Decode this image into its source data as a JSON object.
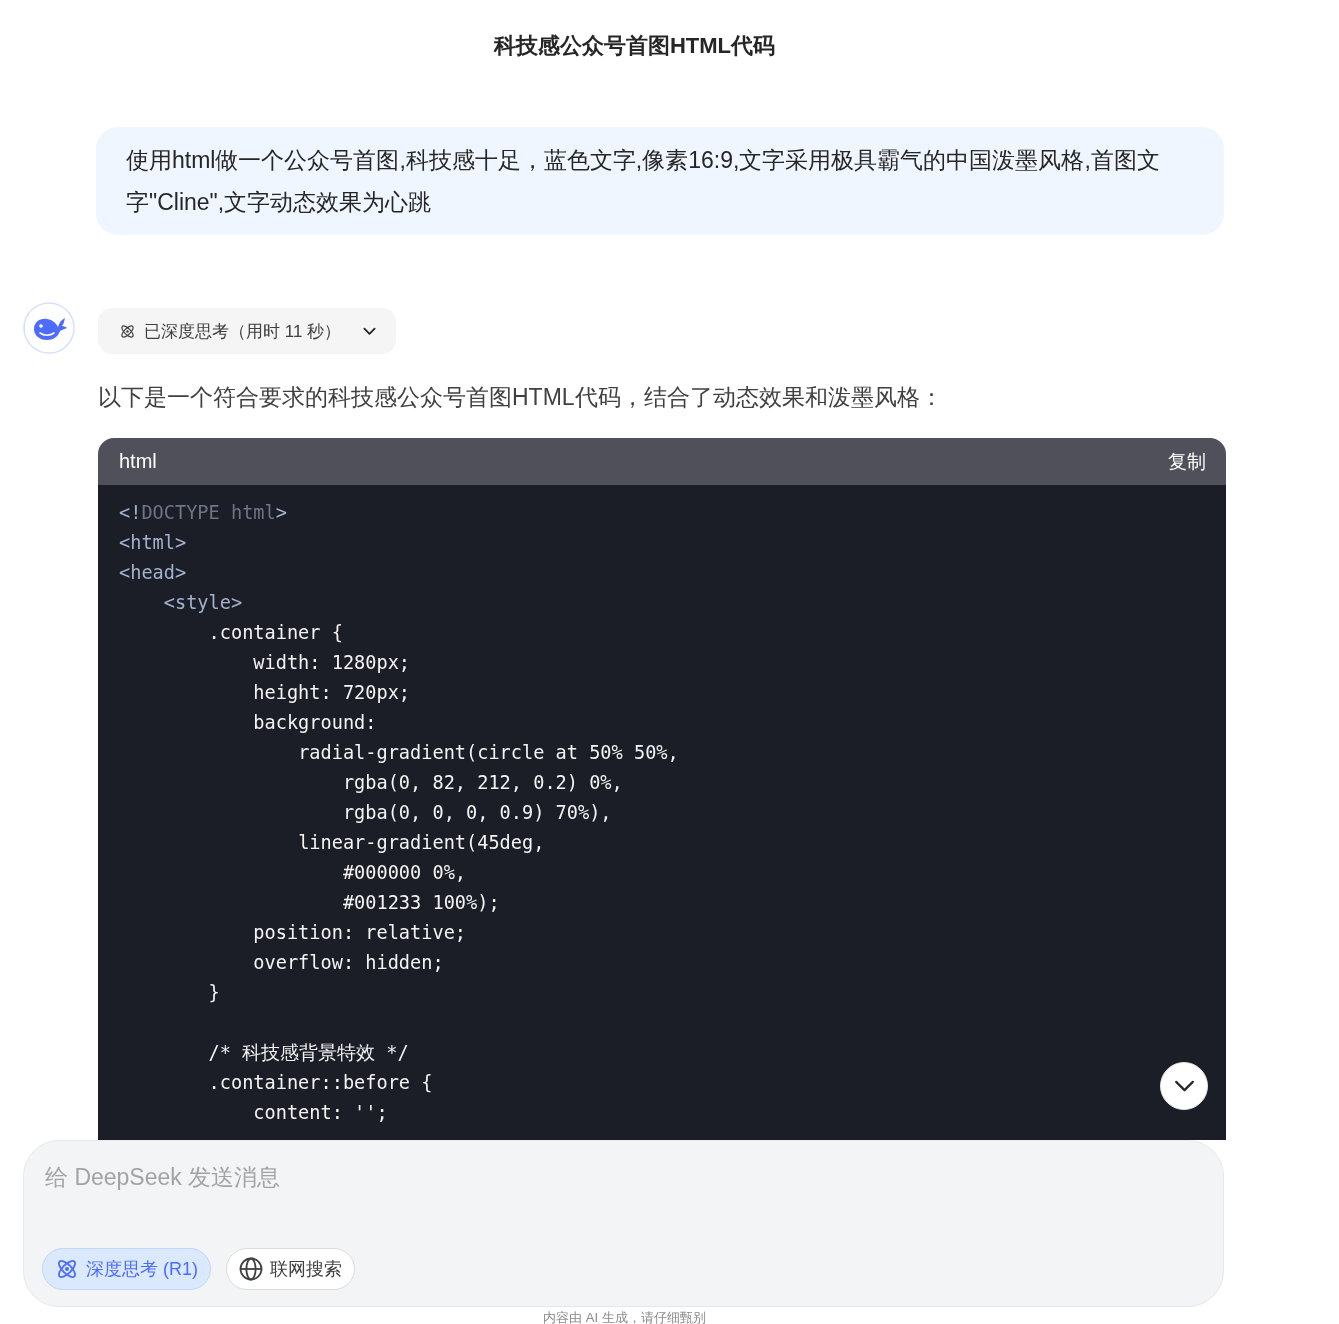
{
  "header": {
    "title": "科技感公众号首图HTML代码"
  },
  "user_message": {
    "text": "使用html做一个公众号首图,科技感十足，蓝色文字,像素16:9,文字采用极具霸气的中国泼墨风格,首图文字\"Cline\",文字动态效果为心跳"
  },
  "assistant": {
    "thinking": {
      "label": "已深度思考（用时 11 秒）",
      "expanded": false
    },
    "intro": "以下是一个符合要求的科技感公众号首图HTML代码，结合了动态效果和泼墨风格：",
    "code_block": {
      "language": "html",
      "copy_label": "复制",
      "lines": [
        {
          "kind": "code",
          "segments": [
            {
              "kind": "tag",
              "text": "<!"
            },
            {
              "kind": "doctype",
              "text": "DOCTYPE html"
            },
            {
              "kind": "tag",
              "text": ">"
            }
          ]
        },
        {
          "kind": "code",
          "segments": [
            {
              "kind": "tag",
              "text": "<html>"
            }
          ]
        },
        {
          "kind": "code",
          "segments": [
            {
              "kind": "tag",
              "text": "<head>"
            }
          ]
        },
        {
          "kind": "code",
          "segments": [
            {
              "kind": "tag",
              "text": "    <style>"
            }
          ]
        },
        {
          "kind": "code",
          "segments": [
            {
              "kind": "plain",
              "text": "        .container {"
            }
          ]
        },
        {
          "kind": "code",
          "segments": [
            {
              "kind": "plain",
              "text": "            width: 1280px;"
            }
          ]
        },
        {
          "kind": "code",
          "segments": [
            {
              "kind": "plain",
              "text": "            height: 720px;"
            }
          ]
        },
        {
          "kind": "code",
          "segments": [
            {
              "kind": "plain",
              "text": "            background:"
            }
          ]
        },
        {
          "kind": "code",
          "segments": [
            {
              "kind": "plain",
              "text": "                radial-gradient(circle at 50% 50%,"
            }
          ]
        },
        {
          "kind": "code",
          "segments": [
            {
              "kind": "plain",
              "text": "                    rgba(0, 82, 212, 0.2) 0%,"
            }
          ]
        },
        {
          "kind": "code",
          "segments": [
            {
              "kind": "plain",
              "text": "                    rgba(0, 0, 0, 0.9) 70%),"
            }
          ]
        },
        {
          "kind": "code",
          "segments": [
            {
              "kind": "plain",
              "text": "                linear-gradient(45deg,"
            }
          ]
        },
        {
          "kind": "code",
          "segments": [
            {
              "kind": "plain",
              "text": "                    #000000 0%,"
            }
          ]
        },
        {
          "kind": "code",
          "segments": [
            {
              "kind": "plain",
              "text": "                    #001233 100%);"
            }
          ]
        },
        {
          "kind": "code",
          "segments": [
            {
              "kind": "plain",
              "text": "            position: relative;"
            }
          ]
        },
        {
          "kind": "code",
          "segments": [
            {
              "kind": "plain",
              "text": "            overflow: hidden;"
            }
          ]
        },
        {
          "kind": "code",
          "segments": [
            {
              "kind": "plain",
              "text": "        }"
            }
          ]
        },
        {
          "kind": "blank"
        },
        {
          "kind": "code",
          "segments": [
            {
              "kind": "plain",
              "text": "        /* 科技感背景特效 */"
            }
          ]
        },
        {
          "kind": "code",
          "segments": [
            {
              "kind": "plain",
              "text": "        .container::before {"
            }
          ]
        },
        {
          "kind": "code",
          "segments": [
            {
              "kind": "plain",
              "text": "            content: '';"
            }
          ]
        }
      ]
    }
  },
  "composer": {
    "placeholder": "给 DeepSeek 发送消息",
    "toggles": [
      {
        "kind": "deep-think",
        "label": "深度思考 (R1)",
        "selected": true
      },
      {
        "kind": "web-search",
        "label": "联网搜索",
        "selected": false
      }
    ]
  },
  "footer_note": "内容由 AI 生成，请仔细甄别"
}
